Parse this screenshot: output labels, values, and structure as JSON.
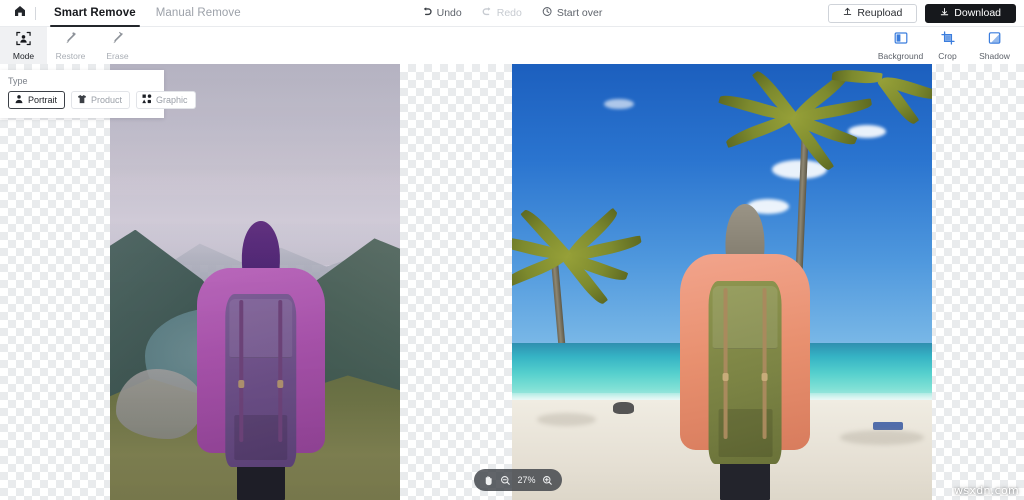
{
  "app": {
    "home_icon": "home-icon",
    "tabs": [
      {
        "label": "Smart Remove",
        "active": true
      },
      {
        "label": "Manual Remove",
        "active": false
      }
    ],
    "history_tools": [
      {
        "label": "Undo",
        "icon": "undo-arrow-icon",
        "enabled": true
      },
      {
        "label": "Redo",
        "icon": "redo-arrow-icon",
        "enabled": false
      },
      {
        "label": "Start over",
        "icon": "refresh-clock-icon",
        "enabled": true
      }
    ],
    "actions": {
      "reupload": {
        "label": "Reupload",
        "icon": "upload-icon"
      },
      "download": {
        "label": "Download",
        "icon": "download-icon"
      }
    }
  },
  "toolbar": {
    "left_tools": [
      {
        "label": "Mode",
        "icon": "person-in-frame-icon",
        "selected": true
      },
      {
        "label": "Restore",
        "icon": "restore-brush-icon",
        "selected": false
      },
      {
        "label": "Erase",
        "icon": "erase-brush-icon",
        "selected": false
      }
    ],
    "right_tools": [
      {
        "label": "Background",
        "icon": "background-panel-icon"
      },
      {
        "label": "Crop",
        "icon": "crop-icon"
      },
      {
        "label": "Shadow",
        "icon": "shadow-square-icon"
      }
    ]
  },
  "type_panel": {
    "title": "Type",
    "options": [
      {
        "label": "Portrait",
        "icon": "person-icon",
        "selected": true
      },
      {
        "label": "Product",
        "icon": "tshirt-icon",
        "selected": false
      },
      {
        "label": "Graphic",
        "icon": "shapes-icon",
        "selected": false
      }
    ]
  },
  "canvas": {
    "left_image_alt": "Hiker with backpack on mountain ridge, purple tinted",
    "right_image_alt": "Hiker with backpack on tropical beach with palm trees"
  },
  "zoom_control": {
    "pan_icon": "hand-pan-icon",
    "zoom_out_icon": "zoom-out-icon",
    "zoom_in_icon": "zoom-in-icon",
    "value": "27%"
  },
  "watermark": {
    "text": "wsxdn.com"
  },
  "colors": {
    "accent_blue": "#3b7ddd",
    "dark_button": "#16181c",
    "text_primary": "#16181c",
    "text_muted": "#9ca1a9",
    "checker": "#e9ebed"
  }
}
